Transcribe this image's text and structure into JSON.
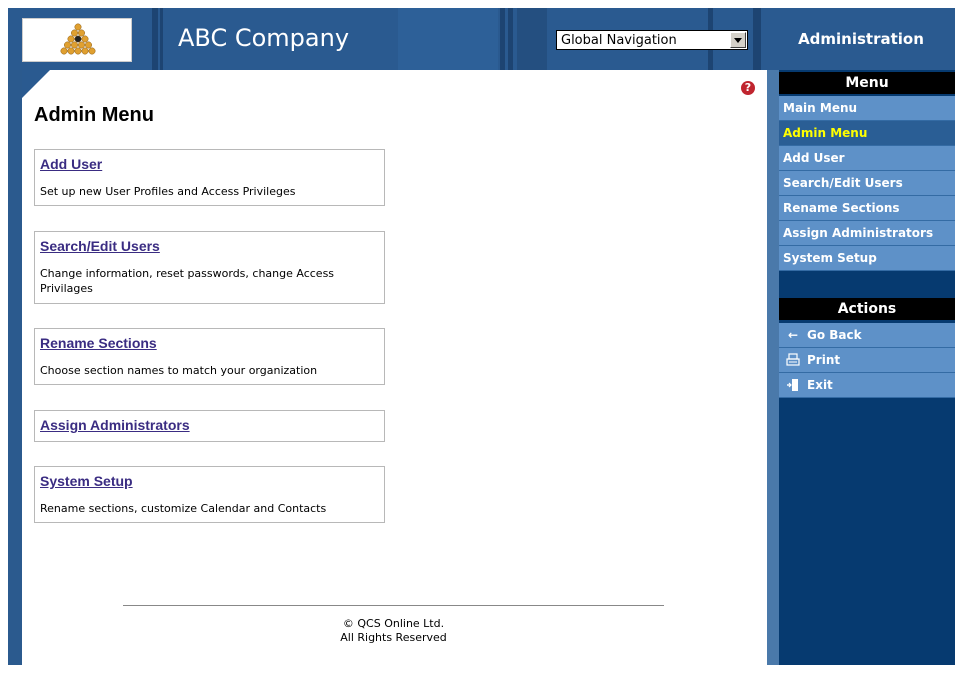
{
  "header": {
    "company_name": "ABC Company",
    "global_nav_value": "Global Navigation"
  },
  "main": {
    "title": "Admin Menu",
    "cards": [
      {
        "title": "Add User",
        "description": "Set up new User Profiles and Access Privileges"
      },
      {
        "title": "Search/Edit Users",
        "description": "Change information, reset passwords, change Access Privilages"
      },
      {
        "title": "Rename Sections",
        "description": "Choose section names to match your organization"
      },
      {
        "title": "Assign Administrators",
        "description": ""
      },
      {
        "title": "System Setup",
        "description": "Rename sections, customize Calendar and Contacts"
      }
    ],
    "footer_line1": "© QCS Online Ltd.",
    "footer_line2": "All Rights Reserved"
  },
  "sidebar": {
    "title": "Administration",
    "menu_heading": "Menu",
    "menu_items": [
      "Main Menu",
      "Admin Menu",
      "Add User",
      "Search/Edit Users",
      "Rename Sections",
      "Assign Administrators",
      "System Setup"
    ],
    "active_item": "Admin Menu",
    "actions_heading": "Actions",
    "actions": [
      {
        "label": "Go Back",
        "icon": "arrow-left-icon"
      },
      {
        "label": "Print",
        "icon": "printer-icon"
      },
      {
        "label": "Exit",
        "icon": "exit-door-icon"
      }
    ]
  },
  "colors": {
    "header_blue": "#2a5a90",
    "sidebar_dark": "#063a70",
    "sidebar_item": "#5e91c8",
    "active_text": "#ffff00",
    "link": "#3a2c82"
  }
}
